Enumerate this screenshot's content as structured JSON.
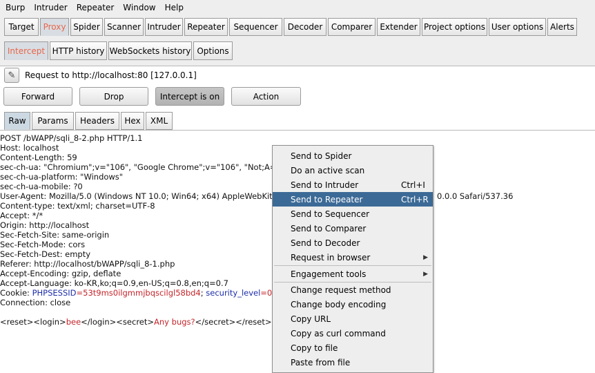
{
  "menubar": [
    "Burp",
    "Intruder",
    "Repeater",
    "Window",
    "Help"
  ],
  "main_tabs": [
    "Target",
    "Proxy",
    "Spider",
    "Scanner",
    "Intruder",
    "Repeater",
    "Sequencer",
    "Decoder",
    "Comparer",
    "Extender",
    "Project options",
    "User options",
    "Alerts"
  ],
  "proxy_tabs": [
    "Intercept",
    "HTTP history",
    "WebSockets history",
    "Options"
  ],
  "intercept": {
    "request_label": "Request to http://localhost:80  [127.0.0.1]",
    "forward": "Forward",
    "drop": "Drop",
    "intercept_toggle": "Intercept is on",
    "action": "Action"
  },
  "view_tabs": [
    "Raw",
    "Params",
    "Headers",
    "Hex",
    "XML"
  ],
  "request": {
    "lines": [
      "POST /bWAPP/sqli_8-2.php HTTP/1.1",
      "Host: localhost",
      "Content-Length: 59",
      "sec-ch-ua: \"Chromium\";v=\"106\", \"Google Chrome\";v=\"106\", \"Not;A=Br",
      "sec-ch-ua-platform: \"Windows\"",
      "sec-ch-ua-mobile: ?0",
      "User-Agent: Mozilla/5.0 (Windows NT 10.0; Win64; x64) AppleWebKit/",
      "Content-type: text/xml; charset=UTF-8",
      "Accept: */*",
      "Origin: http://localhost",
      "Sec-Fetch-Site: same-origin",
      "Sec-Fetch-Mode: cors",
      "Sec-Fetch-Dest: empty",
      "Referer: http://localhost/bWAPP/sqli_8-1.php",
      "Accept-Encoding: gzip, deflate",
      "Accept-Language: ko-KR,ko;q=0.9,en-US;q=0.8,en;q=0.7"
    ],
    "ua_tail": "0.0.0 Safari/537.36",
    "cookie": {
      "prefix": "Cookie: ",
      "name1": "PHPSESSID",
      "val1": "=53t9ms0ilgmmjbqscilgl58bd4",
      "sep": "; ",
      "name2": "security_level",
      "val2": "=0"
    },
    "connection": "Connection: close",
    "xml": {
      "t1": "<reset><login>",
      "v1": "bee",
      "t2": "</login><secret>",
      "v2": "Any bugs?",
      "t3": "</secret></reset>"
    }
  },
  "context_menu": [
    {
      "label": "Send to Spider"
    },
    {
      "label": "Do an active scan"
    },
    {
      "label": "Send to Intruder",
      "shortcut": "Ctrl+I"
    },
    {
      "label": "Send to Repeater",
      "shortcut": "Ctrl+R",
      "highlighted": true
    },
    {
      "label": "Send to Sequencer"
    },
    {
      "label": "Send to Comparer"
    },
    {
      "label": "Send to Decoder"
    },
    {
      "label": "Request in browser",
      "submenu": true
    },
    {
      "label": "Engagement tools",
      "submenu": true
    },
    {
      "label": "Change request method"
    },
    {
      "label": "Change body encoding"
    },
    {
      "label": "Copy URL"
    },
    {
      "label": "Copy as curl command"
    },
    {
      "label": "Copy to file"
    },
    {
      "label": "Paste from file"
    }
  ],
  "colors": {
    "active_tab_text": "#e8664a",
    "menu_highlight": "#3c6a96",
    "param_name": "#1c2ea8",
    "param_value": "#c4252b"
  }
}
